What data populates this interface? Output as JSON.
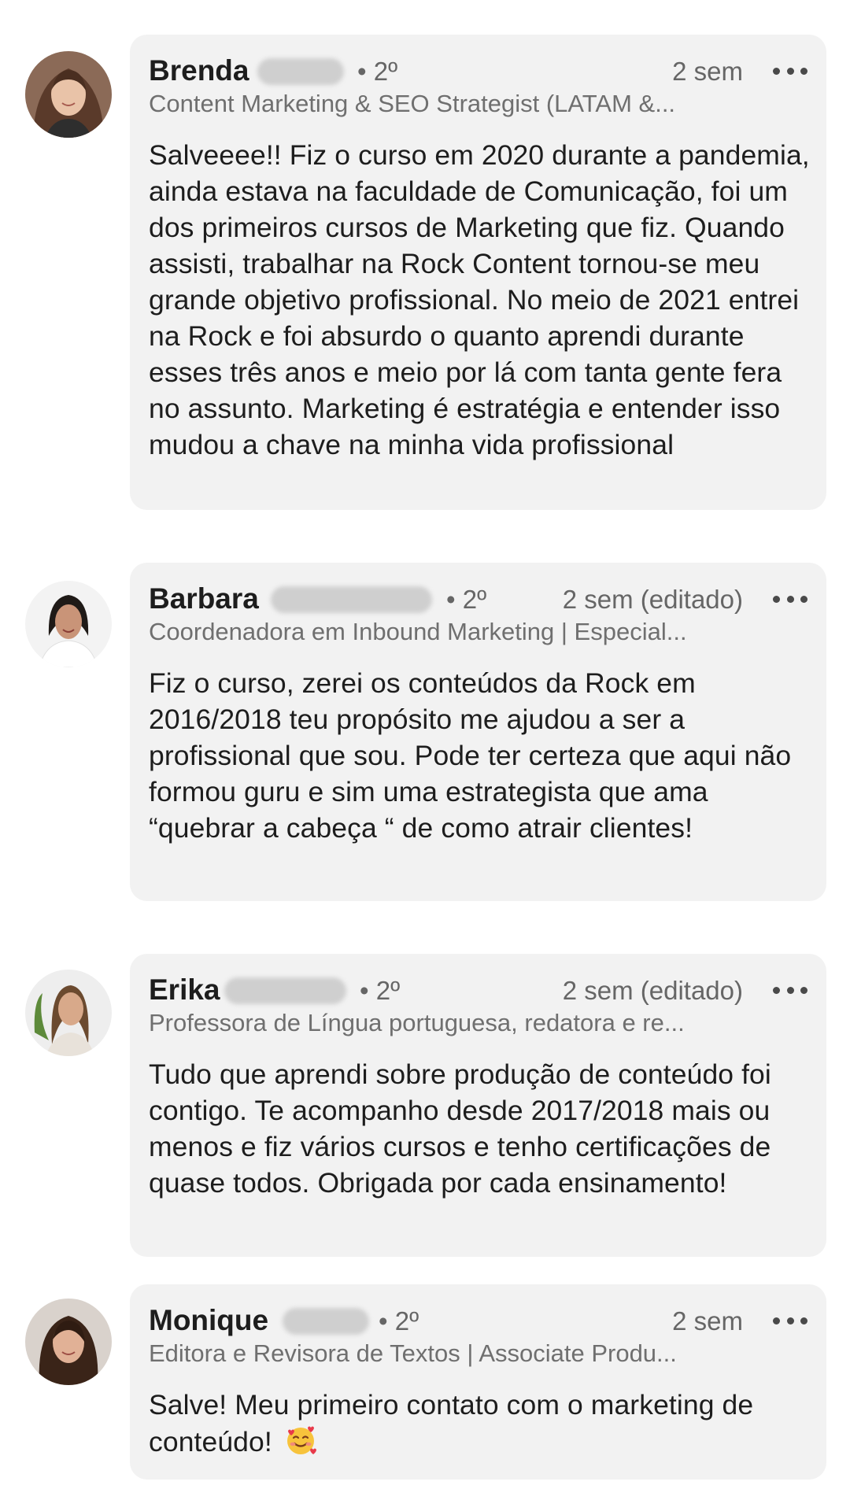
{
  "comments": [
    {
      "name": "Brenda",
      "degree": "• 2º",
      "time": "2 sem",
      "headline": "Content Marketing & SEO Strategist (LATAM &...",
      "text": "Salveeee!! Fiz o curso em 2020 durante a pandemia, ainda estava na faculdade de Comunicação, foi um dos primeiros cursos de Marketing que fiz. Quando assisti, trabalhar na Rock Content tornou-se meu grande objetivo profissional. No meio de 2021 entrei na Rock e foi absurdo o quanto aprendi durante esses três anos e meio por lá com tanta gente fera no assunto. Marketing é estratégia e entender isso mudou a chave na minha vida profissional",
      "avatar_icon": "profile-photo-avatar"
    },
    {
      "name": "Barbara",
      "degree": "• 2º",
      "time": "2 sem (editado)",
      "headline": "Coordenadora em Inbound Marketing | Especial...",
      "text": "Fiz o curso, zerei os conteúdos da Rock em 2016/2018 teu propósito me ajudou a ser a profissional que sou. Pode ter certeza que aqui não formou guru e sim uma estrategista que ama “quebrar a cabeça “ de como atrair clientes!",
      "avatar_icon": "profile-photo-avatar"
    },
    {
      "name": "Erika",
      "degree": "• 2º",
      "time": "2 sem (editado)",
      "headline": "Professora de Língua portuguesa, redatora e re...",
      "text": "Tudo que aprendi sobre produção de conteúdo foi contigo. Te acompanho desde 2017/2018 mais ou menos e fiz vários cursos e tenho certificações de quase todos. Obrigada por cada ensinamento!",
      "avatar_icon": "profile-photo-avatar"
    },
    {
      "name": "Monique",
      "degree": "• 2º",
      "time": "2 sem",
      "headline": "Editora e Revisora de Textos | Associate Produ...",
      "text": "Salve! Meu primeiro contato com o marketing de conteúdo!",
      "emoji": "smiling-face-with-hearts-icon",
      "avatar_icon": "profile-photo-avatar"
    }
  ],
  "more_icon": "more-horizontal-icon",
  "colors": {
    "bubble_bg": "#f2f2f2",
    "secondary_text": "#666666",
    "primary_text": "#1d1d1d"
  }
}
